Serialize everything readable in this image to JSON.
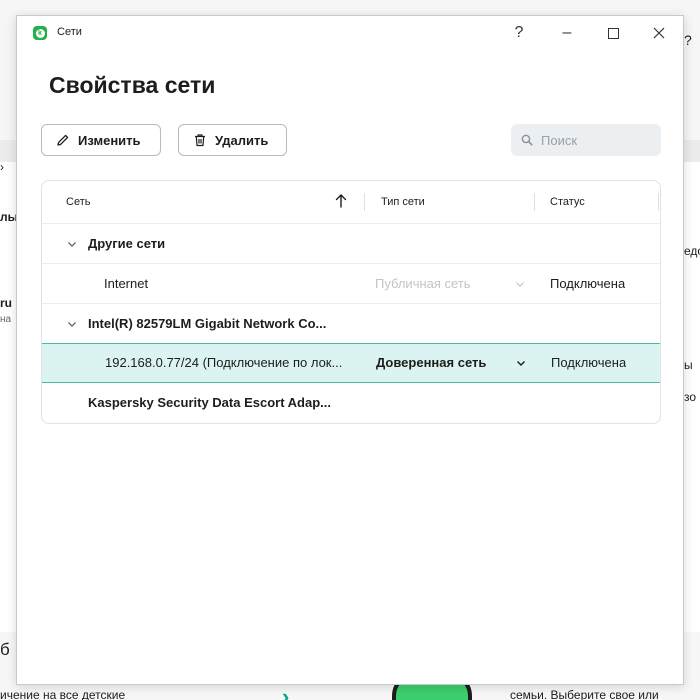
{
  "background": {
    "fragments": [
      "›",
      "лы",
      "ru",
      "на",
      "едо",
      "ы",
      "зо",
      "?",
      "б",
      "ичение на все детские",
      "семьи. Выберите свое или"
    ]
  },
  "window": {
    "title": "Сети",
    "help_label": "?",
    "min_label": "–",
    "max_label": "☐",
    "close_label": "✕"
  },
  "page": {
    "title": "Свойства сети"
  },
  "toolbar": {
    "edit_label": "Изменить",
    "delete_label": "Удалить",
    "search_placeholder": "Поиск"
  },
  "table": {
    "columns": {
      "network": "Сеть",
      "type": "Тип сети",
      "status": "Статус"
    },
    "rows": [
      {
        "kind": "group",
        "label": "Другие сети",
        "expanded": true
      },
      {
        "kind": "item",
        "network": "Internet",
        "type": "Публичная сеть",
        "type_state": "disabled",
        "status": "Подключена"
      },
      {
        "kind": "group",
        "label": "Intel(R) 82579LM Gigabit Network Co...",
        "expanded": true
      },
      {
        "kind": "item",
        "network": "192.168.0.77/24 (Подключение по лок...",
        "type": "Доверенная сеть",
        "type_state": "active",
        "status": "Подключена",
        "selected": true
      },
      {
        "kind": "group-static",
        "label": "Kaspersky Security Data Escort Adap..."
      }
    ]
  },
  "colors": {
    "accent_brand": "#22b14c",
    "selected_row_bg": "#dcf4f1",
    "selected_row_border": "#4fb7ab",
    "muted_text": "#c4c4c4"
  }
}
